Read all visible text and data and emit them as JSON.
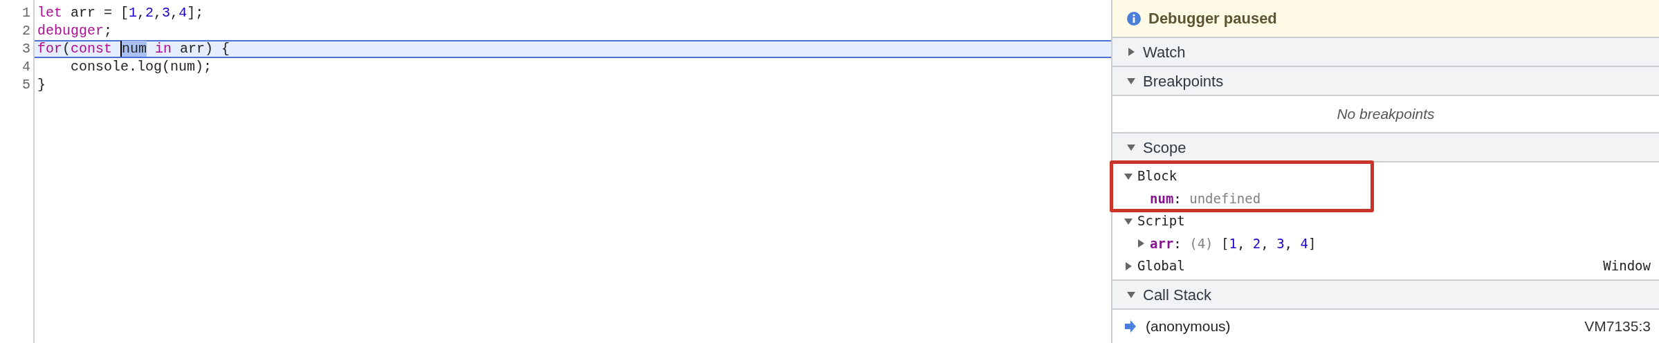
{
  "editor": {
    "lines": [
      {
        "number": "1",
        "current": false,
        "tokens": [
          {
            "text": "let",
            "kind": "keyword"
          },
          {
            "text": " arr = [",
            "kind": "plain"
          },
          {
            "text": "1",
            "kind": "number"
          },
          {
            "text": ",",
            "kind": "plain"
          },
          {
            "text": "2",
            "kind": "number"
          },
          {
            "text": ",",
            "kind": "plain"
          },
          {
            "text": "3",
            "kind": "number"
          },
          {
            "text": ",",
            "kind": "plain"
          },
          {
            "text": "4",
            "kind": "number"
          },
          {
            "text": "];",
            "kind": "plain"
          }
        ]
      },
      {
        "number": "2",
        "current": false,
        "tokens": [
          {
            "text": "debugger",
            "kind": "keyword"
          },
          {
            "text": ";",
            "kind": "plain"
          }
        ]
      },
      {
        "number": "3",
        "current": true,
        "tokens": [
          {
            "text": "for",
            "kind": "keyword"
          },
          {
            "text": "(",
            "kind": "plain"
          },
          {
            "text": "const ",
            "kind": "keyword"
          },
          {
            "text": "num",
            "kind": "selected"
          },
          {
            "text": " in",
            "kind": "keyword"
          },
          {
            "text": " arr) {",
            "kind": "plain"
          }
        ]
      },
      {
        "number": "4",
        "current": false,
        "tokens": [
          {
            "text": "    console.log(num);",
            "kind": "plain"
          }
        ]
      },
      {
        "number": "5",
        "current": false,
        "tokens": [
          {
            "text": "}",
            "kind": "plain"
          }
        ]
      }
    ]
  },
  "debugger": {
    "banner": "Debugger paused",
    "sections": [
      {
        "title": "Watch",
        "expanded": false
      },
      {
        "title": "Breakpoints",
        "expanded": true,
        "empty_text": "No breakpoints"
      },
      {
        "title": "Scope",
        "expanded": true,
        "scopes": [
          {
            "name": "Block",
            "expanded": true,
            "annotated": true,
            "variables": [
              {
                "name": "num",
                "expandable": false,
                "value": [
                  {
                    "text": ": ",
                    "kind": "plain"
                  },
                  {
                    "text": "undefined",
                    "kind": "muted"
                  }
                ]
              }
            ]
          },
          {
            "name": "Script",
            "expanded": true,
            "annotated": false,
            "variables": [
              {
                "name": "arr",
                "expandable": true,
                "expanded": false,
                "value": [
                  {
                    "text": ": ",
                    "kind": "plain"
                  },
                  {
                    "text": "(4) ",
                    "kind": "muted"
                  },
                  {
                    "text": "[",
                    "kind": "plain"
                  },
                  {
                    "text": "1",
                    "kind": "number"
                  },
                  {
                    "text": ", ",
                    "kind": "plain"
                  },
                  {
                    "text": "2",
                    "kind": "number"
                  },
                  {
                    "text": ", ",
                    "kind": "plain"
                  },
                  {
                    "text": "3",
                    "kind": "number"
                  },
                  {
                    "text": ", ",
                    "kind": "plain"
                  },
                  {
                    "text": "4",
                    "kind": "number"
                  },
                  {
                    "text": "]",
                    "kind": "plain"
                  }
                ]
              }
            ]
          },
          {
            "name": "Global",
            "expanded": false,
            "annotated": false,
            "value": "Window"
          }
        ]
      },
      {
        "title": "Call Stack",
        "expanded": true,
        "frames": [
          {
            "name": "(anonymous)",
            "location": "VM7135:3",
            "selected": true
          }
        ]
      }
    ]
  }
}
